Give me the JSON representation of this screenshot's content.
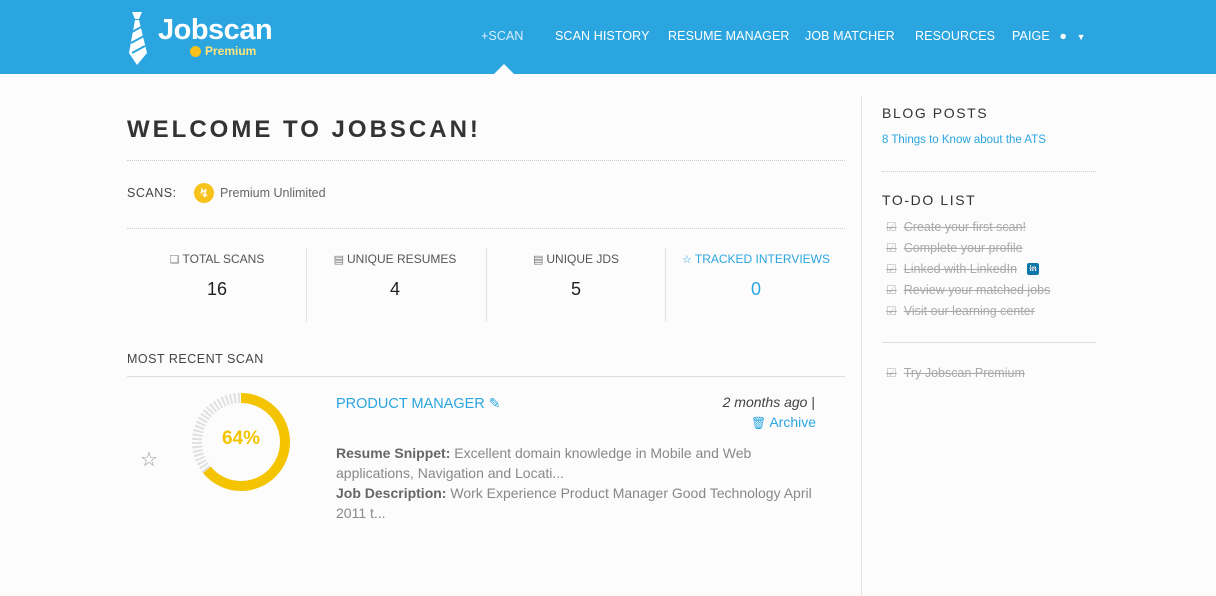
{
  "brand": {
    "name": "Jobscan",
    "tier": "Premium",
    "accent": "#2ba5e0"
  },
  "nav": {
    "items": [
      {
        "label": "SCAN",
        "prefix": "+"
      },
      {
        "label": "SCAN HISTORY"
      },
      {
        "label": "RESUME MANAGER"
      },
      {
        "label": "JOB MATCHER"
      },
      {
        "label": "RESOURCES"
      },
      {
        "label": "PAIGE"
      }
    ],
    "active": "SCAN"
  },
  "main": {
    "title": "WELCOME TO JOBSCAN!",
    "scans_label": "SCANS:",
    "plan": "Premium Unlimited",
    "stats": [
      {
        "label": "TOTAL SCANS",
        "value": "16",
        "icon": "copy-icon"
      },
      {
        "label": "UNIQUE RESUMES",
        "value": "4",
        "icon": "document-icon"
      },
      {
        "label": "UNIQUE JDS",
        "value": "5",
        "icon": "document-icon"
      },
      {
        "label": "TRACKED INTERVIEWS",
        "value": "0",
        "icon": "star-icon"
      }
    ],
    "recent_label": "MOST RECENT SCAN",
    "recent": {
      "score": "64%",
      "score_fraction": 0.64,
      "title": "PRODUCT MANAGER",
      "when": "2 months ago",
      "separator": "|",
      "archive": "Archive",
      "resume_label": "Resume Snippet:",
      "resume_text": "Excellent domain knowledge in Mobile and Web applications, Navigation and Locati...",
      "jd_label": "Job Description:",
      "jd_text": "Work Experience Product Manager Good Technology April 2011 t..."
    }
  },
  "sidebar": {
    "blog_heading": "BLOG POSTS",
    "blog_link": "8 Things to Know about the ATS",
    "todo_heading": "TO-DO LIST",
    "todos": [
      "Create your first scan!",
      "Complete your profile",
      "Linked with LinkedIn",
      "Review your matched jobs",
      "Visit our learning center"
    ],
    "extra_todo": "Try Jobscan Premium",
    "linkedin_badge": "in"
  },
  "colors": {
    "header": "#2ba5e0",
    "gauge": "#f5c400",
    "gauge_track": "#e0e0e0"
  }
}
